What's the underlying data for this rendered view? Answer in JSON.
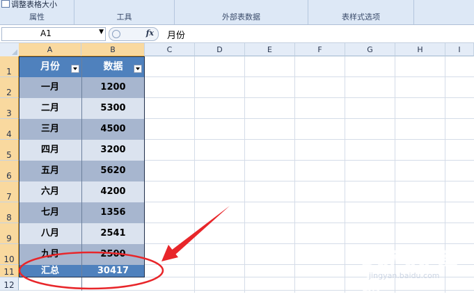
{
  "ribbon": {
    "top_text": "调整表格大小",
    "groups": [
      "属性",
      "工具",
      "外部表数据",
      "表样式选项"
    ]
  },
  "formula_bar": {
    "name_box": "A1",
    "fx": "fx",
    "value": "月份"
  },
  "columns": [
    "A",
    "B",
    "C",
    "D",
    "E",
    "F",
    "G",
    "H",
    "I"
  ],
  "rows": [
    "1",
    "2",
    "3",
    "4",
    "5",
    "6",
    "7",
    "8",
    "9",
    "10",
    "11",
    "12"
  ],
  "table": {
    "headers": [
      "月份",
      "数据"
    ],
    "rows": [
      [
        "一月",
        "1200"
      ],
      [
        "二月",
        "5300"
      ],
      [
        "三月",
        "4500"
      ],
      [
        "四月",
        "3200"
      ],
      [
        "五月",
        "5620"
      ],
      [
        "六月",
        "4200"
      ],
      [
        "七月",
        "1356"
      ],
      [
        "八月",
        "2541"
      ],
      [
        "九月",
        "2500"
      ]
    ],
    "total": [
      "汇总",
      "30417"
    ]
  },
  "annotation": {
    "color": "#e8262a"
  },
  "watermark": {
    "text": "Bai du 经验",
    "sub": "jingyan.baidu.com"
  }
}
